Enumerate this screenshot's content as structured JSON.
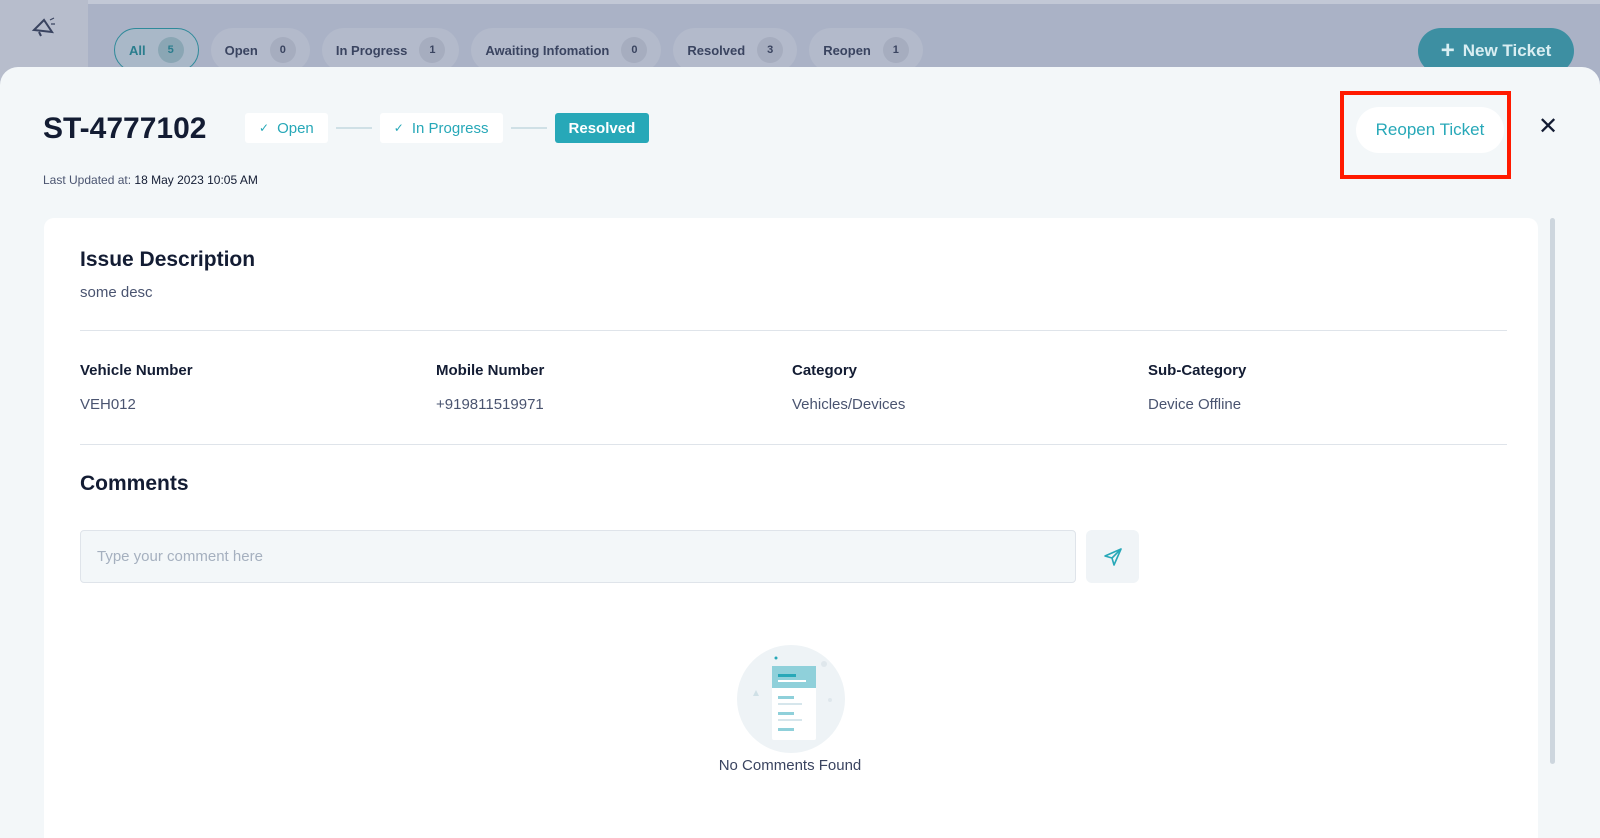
{
  "filters": {
    "tabs": [
      {
        "label": "All",
        "count": "5"
      },
      {
        "label": "Open",
        "count": "0"
      },
      {
        "label": "In Progress",
        "count": "1"
      },
      {
        "label": "Awaiting Infomation",
        "count": "0"
      },
      {
        "label": "Resolved",
        "count": "3"
      },
      {
        "label": "Reopen",
        "count": "1"
      }
    ],
    "new_ticket_label": "New Ticket"
  },
  "ticket": {
    "id": "ST-4777102",
    "steps": [
      {
        "label": "Open",
        "state": "done"
      },
      {
        "label": "In Progress",
        "state": "done"
      },
      {
        "label": "Resolved",
        "state": "current"
      }
    ],
    "last_updated_label": "Last Updated at:",
    "last_updated_value": "18 May 2023 10:05 AM",
    "reopen_label": "Reopen Ticket",
    "issue_title": "Issue Description",
    "issue_desc": "some desc",
    "fields": [
      {
        "label": "Vehicle Number",
        "value": "VEH012"
      },
      {
        "label": "Mobile Number",
        "value": "+919811519971"
      },
      {
        "label": "Category",
        "value": "Vehicles/Devices"
      },
      {
        "label": "Sub-Category",
        "value": "Device Offline"
      }
    ]
  },
  "comments": {
    "title": "Comments",
    "placeholder": "Type your comment here",
    "empty_text": "No Comments Found"
  },
  "colors": {
    "accent": "#27a8b8",
    "highlight": "#ff1a00"
  }
}
